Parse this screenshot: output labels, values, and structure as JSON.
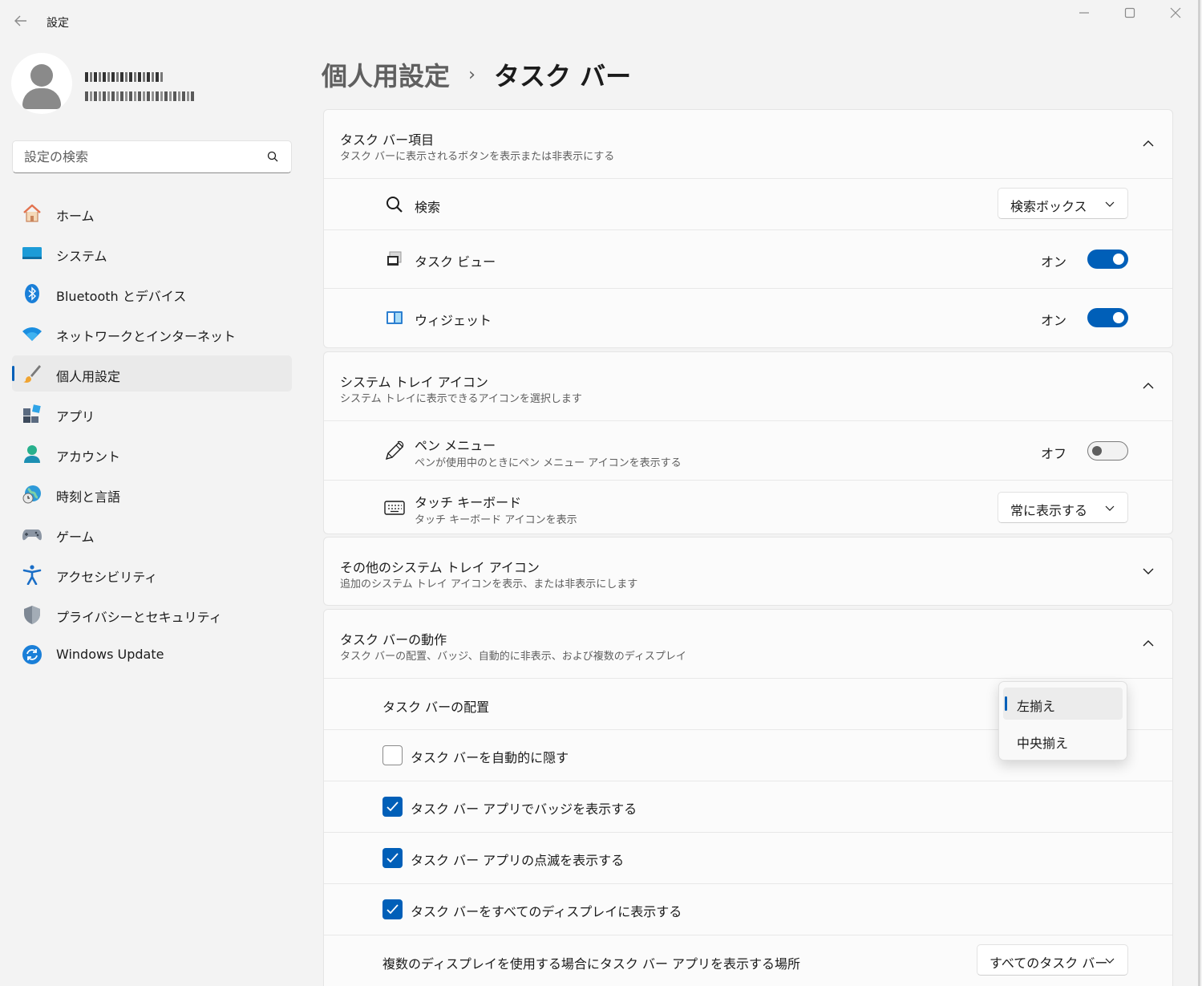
{
  "window": {
    "title": "設定",
    "icons": {
      "back": "back-arrow-icon",
      "minimize": "minimize-icon",
      "maximize": "maximize-icon",
      "close": "close-icon"
    }
  },
  "sidebar": {
    "search_placeholder": "設定の検索",
    "items": [
      {
        "label": "ホーム",
        "icon": "home-icon"
      },
      {
        "label": "システム",
        "icon": "system-icon"
      },
      {
        "label": "Bluetooth とデバイス",
        "icon": "bluetooth-icon"
      },
      {
        "label": "ネットワークとインターネット",
        "icon": "wifi-icon"
      },
      {
        "label": "個人用設定",
        "icon": "brush-icon",
        "selected": true
      },
      {
        "label": "アプリ",
        "icon": "apps-icon"
      },
      {
        "label": "アカウント",
        "icon": "account-icon"
      },
      {
        "label": "時刻と言語",
        "icon": "time-language-icon"
      },
      {
        "label": "ゲーム",
        "icon": "gamepad-icon"
      },
      {
        "label": "アクセシビリティ",
        "icon": "accessibility-icon"
      },
      {
        "label": "プライバシーとセキュリティ",
        "icon": "shield-icon"
      },
      {
        "label": "Windows Update",
        "icon": "windows-update-icon"
      }
    ]
  },
  "header": {
    "parent": "個人用設定",
    "separator": "›",
    "current": "タスク バー"
  },
  "taskbar_items": {
    "title": "タスク バー項目",
    "subtitle": "タスク バーに表示されるボタンを表示または非表示にする",
    "search": {
      "label": "検索",
      "value": "検索ボックス"
    },
    "task_view": {
      "label": "タスク ビュー",
      "state": "オン"
    },
    "widgets": {
      "label": "ウィジェット",
      "state": "オン"
    }
  },
  "system_tray": {
    "title": "システム トレイ アイコン",
    "subtitle": "システム トレイに表示できるアイコンを選択します",
    "pen_menu": {
      "label": "ペン メニュー",
      "desc": "ペンが使用中のときにペン メニュー アイコンを表示する",
      "state": "オフ"
    },
    "touch_keyboard": {
      "label": "タッチ キーボード",
      "desc": "タッチ キーボード アイコンを表示",
      "value": "常に表示する"
    }
  },
  "other_tray": {
    "title": "その他のシステム トレイ アイコン",
    "subtitle": "追加のシステム トレイ アイコンを表示、または非表示にします"
  },
  "behaviors": {
    "title": "タスク バーの動作",
    "subtitle": "タスク バーの配置、バッジ、自動的に非表示、および複数のディスプレイ",
    "alignment": {
      "label": "タスク バーの配置",
      "options": [
        "左揃え",
        "中央揃え"
      ],
      "selected": "左揃え"
    },
    "checkboxes": [
      {
        "label": "タスク バーを自動的に隠す",
        "checked": false
      },
      {
        "label": "タスク バー アプリでバッジを表示する",
        "checked": true
      },
      {
        "label": "タスク バー アプリの点滅を表示する",
        "checked": true
      },
      {
        "label": "タスク バーをすべてのディスプレイに表示する",
        "checked": true
      }
    ],
    "multi_display": {
      "label": "複数のディスプレイを使用する場合にタスク バー アプリを表示する場所",
      "value": "すべてのタスク バー"
    }
  },
  "colors": {
    "accent": "#005fb8",
    "background": "#f3f3f3",
    "card": "#fbfbfb"
  }
}
